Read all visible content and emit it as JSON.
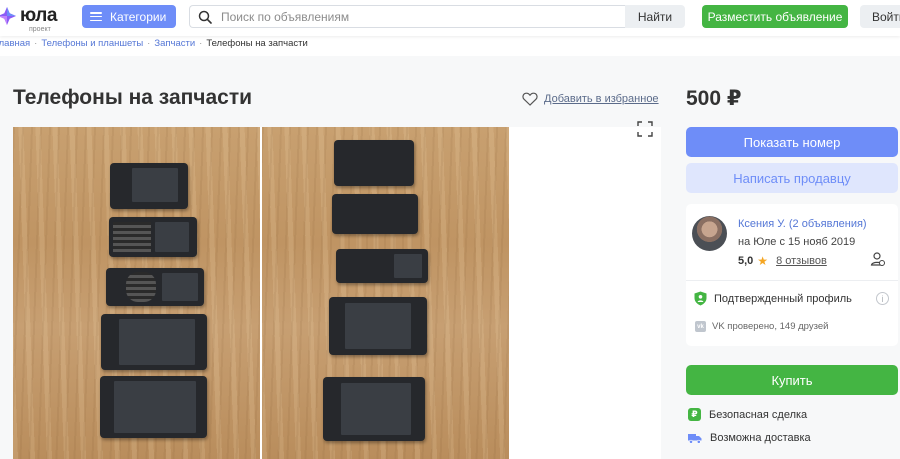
{
  "header": {
    "logo_text": "юла",
    "logo_sub": "проект",
    "categories_label": "Категории",
    "search_placeholder": "Поиск по объявлениям",
    "find_label": "Найти",
    "post_label": "Разместить объявление",
    "login_label": "Войти"
  },
  "breadcrumbs": [
    "Главная",
    "Телефоны и планшеты",
    "Запчасти",
    "Телефоны на запчасти"
  ],
  "listing": {
    "title": "Телефоны на запчасти",
    "favorite_label": "Добавить в избранное",
    "price": "500 ₽"
  },
  "actions": {
    "show_number": "Показать номер",
    "write_seller": "Написать продавцу",
    "buy": "Купить"
  },
  "seller": {
    "name": "Ксения У. (2 объявления)",
    "since": "на Юле с 15 нояб 2019",
    "rating": "5,0",
    "reviews": "8 отзывов",
    "verified_label": "Подтвержденный профиль",
    "vk_text": "VK проверено, 149 друзей"
  },
  "features": {
    "safe_deal": "Безопасная сделка",
    "delivery": "Возможна доставка"
  },
  "colors": {
    "accent_blue": "#6e8df8",
    "accent_green": "#44b543",
    "link_blue": "#5577d6"
  }
}
